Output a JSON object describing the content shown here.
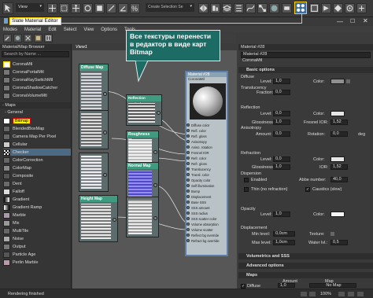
{
  "toolbar": {
    "view_select": "View",
    "selection_set_placeholder": "Create Selection Se",
    "icons": [
      "select-arrow-icon",
      "select-region-icon",
      "pointer-icon",
      "unlink-icon",
      "link-icon",
      "bind-icon",
      "move-icon",
      "rotate-icon",
      "scale-icon",
      "snap-icon",
      "angle-snap-icon",
      "mirror-icon",
      "align-icon",
      "layer-icon",
      "curve-editor-icon",
      "schematic-icon",
      "material-editor-icon",
      "render-setup-icon",
      "render-frame-icon",
      "render-icon"
    ]
  },
  "window": {
    "title": "Slate Material Editor"
  },
  "menu": [
    "Modes",
    "Material",
    "Edit",
    "Select",
    "View",
    "Options",
    "Tools"
  ],
  "left_panel": {
    "title": "Material/Map Browser",
    "search_placeholder": "Search by Name ...",
    "corona_items": [
      "CoronaMtl",
      "CoronaPortalMtl",
      "CoronaRaySwitchMtl",
      "CoronaShadowCatcher",
      "CoronaVolumeMtl"
    ],
    "maps_header": "- Maps",
    "general_header": "- General",
    "map_items": [
      "Bitmap",
      "BlendedBoxMap",
      "Camera Map Per Pixel",
      "Cellular",
      "Checker",
      "ColorCorrection",
      "ColorMap",
      "Composite",
      "Dent",
      "Falloff",
      "Gradient",
      "Gradient Ramp",
      "Marble",
      "Mix",
      "MultiTile",
      "Noise",
      "Output",
      "Particle Age",
      "Perlin Marble"
    ]
  },
  "view_tab": "View1",
  "nodes": {
    "diffuse": "Diffuse Map",
    "reflection": "Reflection Occlusion Map",
    "roughness": "Roughness Map",
    "normal": "Normal Map",
    "height": "Height Map"
  },
  "material_node": {
    "title": "Material #28",
    "subtitle": "CoronaMtl",
    "slots": [
      "Diffuse color",
      "Refl. color",
      "Refl. gloss",
      "Anisotropy",
      "Aniso. rotation",
      "Fresnel IOR",
      "Refr. color",
      "Refr. gloss",
      "Translucency",
      "Transl. color",
      "Opacity color",
      "Self illumination",
      "Bump",
      "Displacement",
      "Base SSS",
      "SSS amount",
      "SSS radius",
      "SSS scatter color",
      "Volume absorption",
      "Volume scatter",
      "Reflect bg override",
      "Refract bg override"
    ]
  },
  "callout": "Все текстуры перенести в редактор в виде карт Bitmap",
  "right_panel": {
    "material_field": "Material #28",
    "material_type": "CoronaMtl",
    "basic_options": "Basic options",
    "diffuse": {
      "header": "Diffuse",
      "level_label": "Level:",
      "level": "1,0",
      "color_label": "Color:"
    },
    "translucency": {
      "header": "Translucency",
      "fraction_label": "Fraction:",
      "fraction": "0,0"
    },
    "reflection": {
      "header": "Reflection",
      "level_label": "Level:",
      "level": "0,0",
      "color_label": "Color:",
      "gloss_label": "Glossiness:",
      "gloss": "1,0",
      "fresnel_label": "Fresnel IOR:",
      "fresnel": "1,52",
      "aniso_header": "Anisotropy",
      "amount_label": "Amount:",
      "amount": "0,0",
      "rotation_label": "Rotation:",
      "rotation": "0,0",
      "deg": "deg"
    },
    "refraction": {
      "header": "Refraction",
      "level_label": "Level:",
      "level": "0,0",
      "color_label": "Color:",
      "gloss_label": "Glossiness:",
      "gloss": "1,0",
      "ior_label": "IOR:",
      "ior": "1,52",
      "dispersion_header": "Dispersion",
      "enabled_label": "Enabled",
      "abbe_label": "Abbe number:",
      "abbe": "40,0",
      "thin_label": "Thin (no refraction)",
      "caustics_label": "Caustics (slow)"
    },
    "opacity": {
      "header": "Opacity",
      "level_label": "Level:",
      "level": "1,0",
      "color_label": "Color:"
    },
    "displacement": {
      "header": "Displacement",
      "min_label": "Min level:",
      "min": "0,0cm",
      "texture_label": "Texture:",
      "max_label": "Max level:",
      "max": "1,0cm",
      "water_label": "Water lvl.:",
      "water": "0,5"
    },
    "volumetrics": "Volumetrics and SSS",
    "advanced": "Advanced options",
    "maps": "Maps",
    "maps_cols": [
      "Amount",
      "Map"
    ],
    "maps_diffuse_label": "Diffuse",
    "maps_diffuse_amount": "1,0",
    "maps_diffuse_map": "No Map"
  },
  "status": {
    "text": "Rendering finished",
    "zoom": "100%"
  }
}
